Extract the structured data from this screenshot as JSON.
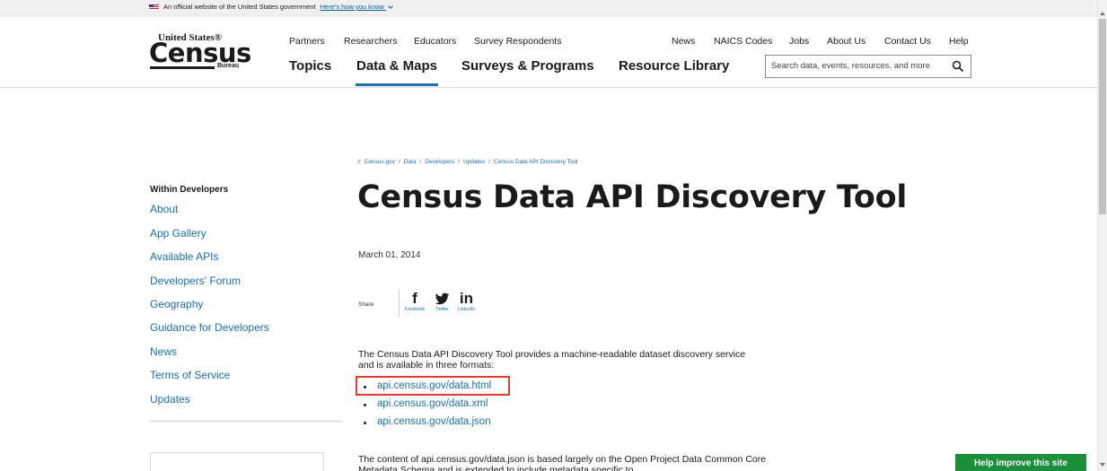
{
  "gov_banner": {
    "text": "An official website of the United States government",
    "link": "Here's how you know",
    "chevron": "chevron-down-icon"
  },
  "logo": {
    "line1": "United States®",
    "line2": "Census",
    "line3": "Bureau"
  },
  "utility_nav": [
    "Partners",
    "Researchers",
    "Educators",
    "Survey Respondents",
    "News",
    "NAICS Codes",
    "Jobs",
    "About Us",
    "Contact Us",
    "Help"
  ],
  "main_nav": [
    "Topics",
    "Data & Maps",
    "Surveys & Programs",
    "Resource Library"
  ],
  "active_nav": "Data & Maps",
  "search": {
    "placeholder": "Search data, events, resources, and more",
    "icon": "search-icon"
  },
  "sidebar": {
    "title": "Within Developers",
    "items": [
      "About",
      "App Gallery",
      "Available APIs",
      "Developers' Forum",
      "Geography",
      "Guidance for Developers",
      "News",
      "Terms of Service",
      "Updates"
    ]
  },
  "breadcrumb": {
    "prefix": "//",
    "items": [
      "Census.gov",
      "Data",
      "Developers",
      "Updates",
      "Census Data API Discovery Tool"
    ]
  },
  "article": {
    "title": "Census Data API Discovery Tool",
    "date": "March 01, 2014",
    "share_label": "Share",
    "social": [
      {
        "glyph": "f",
        "label": "Facebook",
        "icon": "facebook-icon"
      },
      {
        "glyph": "🐦",
        "label": "Twitter",
        "icon": "twitter-icon"
      },
      {
        "glyph": "in",
        "label": "LinkedIn",
        "icon": "linkedin-icon"
      }
    ],
    "intro": "The Census Data API Discovery Tool provides a machine-readable dataset discovery service and is available in three formats:",
    "links": [
      "api.census.gov/data.html",
      "api.census.gov/data.xml",
      "api.census.gov/data.json"
    ],
    "paragraph2": "The content of api.census.gov/data.json is based largely on the Open Project Data Common Core Metadata Schema and is extended to include metadata specific to"
  },
  "help_button": "Help improve this site",
  "colors": {
    "link": "#1a6fa8",
    "highlight": "#e03c31",
    "help_button": "#1b8f3a"
  }
}
